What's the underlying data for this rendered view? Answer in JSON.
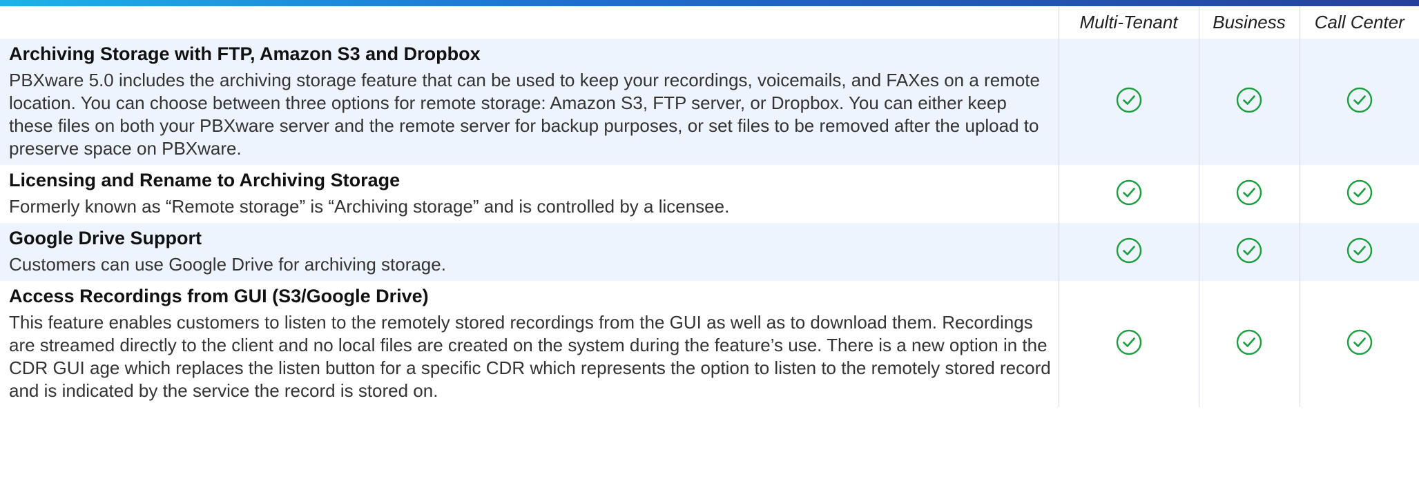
{
  "colors": {
    "accent_bar_start": "#1db3e8",
    "accent_bar_end": "#25409a",
    "row_shade": "#eef4fe",
    "check_green": "#1b9e3f"
  },
  "plans": [
    "Multi-Tenant",
    "Business",
    "Call Center"
  ],
  "features": [
    {
      "title": "Archiving  Storage with FTP, Amazon S3 and Dropbox",
      "description": "PBXware 5.0 includes the archiving storage feature that can be used to keep your recordings, voicemails, and FAXes on a remote location. You can choose between three options for remote storage: Amazon S3, FTP server, or Dropbox. You can either keep these files on both your PBXware server and the remote server for backup purposes, or set files to be removed after the upload to preserve space on PBXware.",
      "availability": [
        "check-icon",
        "check-icon",
        "check-icon"
      ]
    },
    {
      "title": "Licensing and Rename to Archiving Storage",
      "description": "Formerly known as “Remote storage” is  “Archiving storage” and is controlled by a licensee.",
      "availability": [
        "check-icon",
        "check-icon",
        "check-icon"
      ]
    },
    {
      "title": "Google Drive Support",
      "description": "Customers can use Google Drive for archiving storage.",
      "availability": [
        "check-icon",
        "check-icon",
        "check-icon"
      ]
    },
    {
      "title": "Access Recordings from GUI (S3/Google Drive)",
      "description": "This feature enables customers to listen to the remotely stored recordings from the GUI as well as to download them. Recordings are streamed directly to the client and no local files are created on the system during the feature’s use. There is a new option in the CDR GUI age which replaces the listen button for a specific CDR which represents the option to listen to the remotely stored record and is indicated by the service the record is stored on.",
      "availability": [
        "check-icon",
        "check-icon",
        "check-icon"
      ]
    }
  ]
}
